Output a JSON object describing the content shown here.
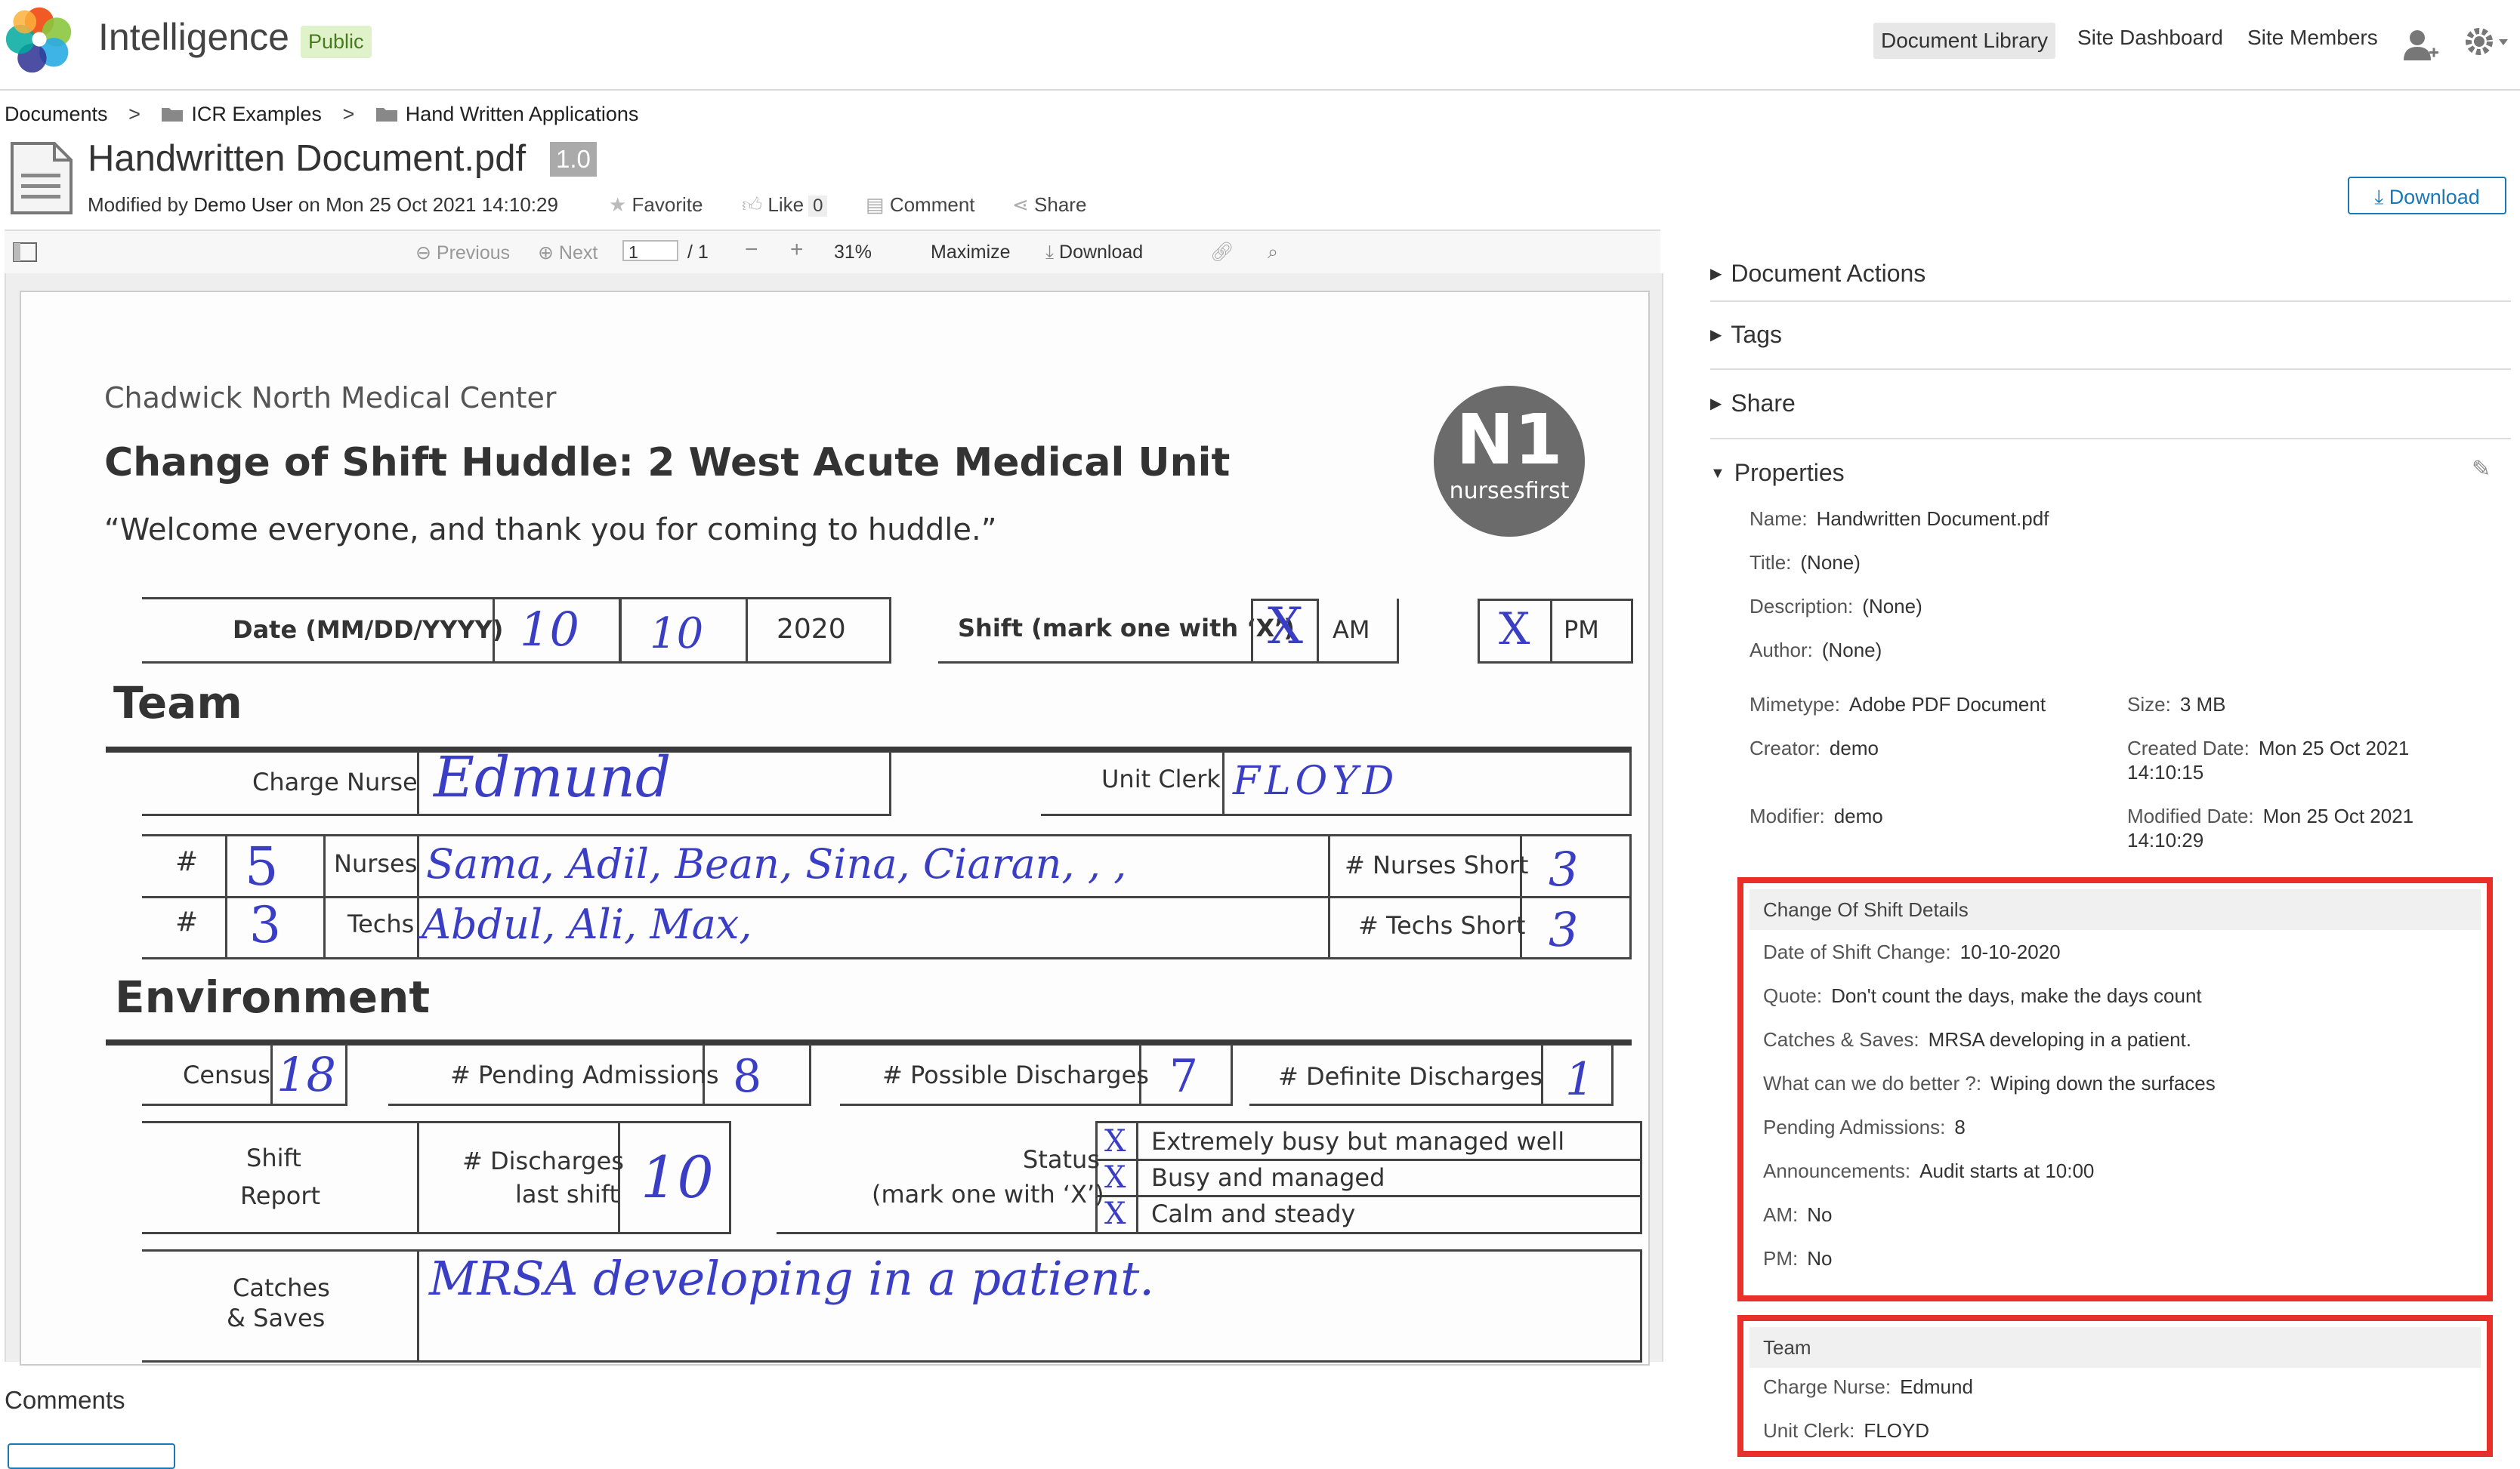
{
  "header": {
    "site_title": "Intelligence",
    "visibility": "Public",
    "nav": [
      "Document Library",
      "Site Dashboard",
      "Site Members"
    ],
    "icons": [
      "user-add-icon",
      "gear-icon"
    ]
  },
  "breadcrumb": [
    "Documents",
    "ICR Examples",
    "Hand Written Applications"
  ],
  "document": {
    "title": "Handwritten Document.pdf",
    "version": "1.0",
    "modified_prefix": "Modified by",
    "modified_user": "Demo User",
    "modified_on": "on Mon 25 Oct 2021 14:10:29",
    "favorite": "Favorite",
    "like": "Like",
    "like_count": "0",
    "comment": "Comment",
    "share": "Share",
    "download": "Download"
  },
  "viewer": {
    "previous": "Previous",
    "next": "Next",
    "page_value": "1",
    "page_total": "/ 1",
    "zoom": "31%",
    "maximize": "Maximize",
    "download": "Download"
  },
  "form": {
    "org": "Chadwick North Medical Center",
    "heading": "Change of Shift Huddle: 2 West Acute Medical Unit",
    "welcome": "“Welcome everyone, and thank you for coming to huddle.”",
    "logo_text": "nursesfirst",
    "logo_mark": "N1",
    "date_label": "Date (MM/DD/YYYY)",
    "date_mm": "10",
    "date_dd": "10",
    "date_yyyy": "2020",
    "shift_label": "Shift (mark one with ‘X’)",
    "shift_am_mark": "X",
    "shift_am": "AM",
    "shift_pm_mark": "X",
    "shift_pm": "PM",
    "team_heading": "Team",
    "charge_nurse_label": "Charge Nurse",
    "charge_nurse_value": "Edmund",
    "unit_clerk_label": "Unit Clerk",
    "unit_clerk_value": "FLOYD",
    "hash": "#",
    "nurses_count": "5",
    "nurses_label": "Nurses",
    "nurses_names": "Sama, Adil, Bean, Sina, Ciaran,    ,    ,",
    "nurses_short_label": "# Nurses Short",
    "nurses_short_value": "3",
    "techs_count": "3",
    "techs_label": "Techs",
    "techs_names": "Abdul, Ali, Max,",
    "techs_short_label": "# Techs Short",
    "techs_short_value": "3",
    "env_heading": "Environment",
    "census_label": "Census",
    "census_value": "18",
    "pending_label": "# Pending Admissions",
    "pending_value": "8",
    "possible_label": "# Possible Discharges",
    "possible_value": "7",
    "definite_label": "# Definite Discharges",
    "definite_value": "1",
    "shift_report_1": "Shift",
    "shift_report_2": "Report",
    "discharges_label_1": "# Discharges",
    "discharges_label_2": "last shift",
    "discharges_value": "10",
    "status_label_1": "Status",
    "status_label_2": "(mark one with ‘X’)",
    "status_options": [
      "Extremely busy but managed well",
      "Busy and managed",
      "Calm and steady"
    ],
    "status_mark": "X",
    "catches_label_1": "Catches",
    "catches_label_2": "& Saves",
    "catches_value": "MRSA developing in a patient."
  },
  "comments": {
    "label": "Comments"
  },
  "panel": {
    "sections": [
      "Document Actions",
      "Tags",
      "Share",
      "Properties"
    ],
    "properties": {
      "name_label": "Name:",
      "name": "Handwritten Document.pdf",
      "title_label": "Title:",
      "title": "(None)",
      "description_label": "Description:",
      "description": "(None)",
      "author_label": "Author:",
      "author": "(None)",
      "mimetype_label": "Mimetype:",
      "mimetype": "Adobe PDF Document",
      "size_label": "Size:",
      "size": "3 MB",
      "creator_label": "Creator:",
      "creator": "demo",
      "created_label": "Created Date:",
      "created_1": "Mon 25 Oct 2021",
      "created_2": "14:10:15",
      "modifier_label": "Modifier:",
      "modifier": "demo",
      "modified_label": "Modified Date:",
      "modified_1": "Mon 25 Oct 2021",
      "modified_2": "14:10:29"
    },
    "shift_details": {
      "title": "Change Of Shift Details",
      "rows": [
        {
          "label": "Date of Shift Change:",
          "value": "10-10-2020"
        },
        {
          "label": "Quote:",
          "value": "Don't count the days, make the days count"
        },
        {
          "label": "Catches & Saves:",
          "value": "MRSA developing in a patient."
        },
        {
          "label": "What can we do better ?:",
          "value": "Wiping down the surfaces"
        },
        {
          "label": "Pending Admissions:",
          "value": "8"
        },
        {
          "label": "Announcements:",
          "value": "Audit starts at 10:00"
        },
        {
          "label": "AM:",
          "value": "No"
        },
        {
          "label": "PM:",
          "value": "No"
        }
      ]
    },
    "team": {
      "title": "Team",
      "rows": [
        {
          "label": "Charge Nurse:",
          "value": "Edmund"
        },
        {
          "label": "Unit Clerk:",
          "value": "FLOYD"
        }
      ]
    }
  }
}
